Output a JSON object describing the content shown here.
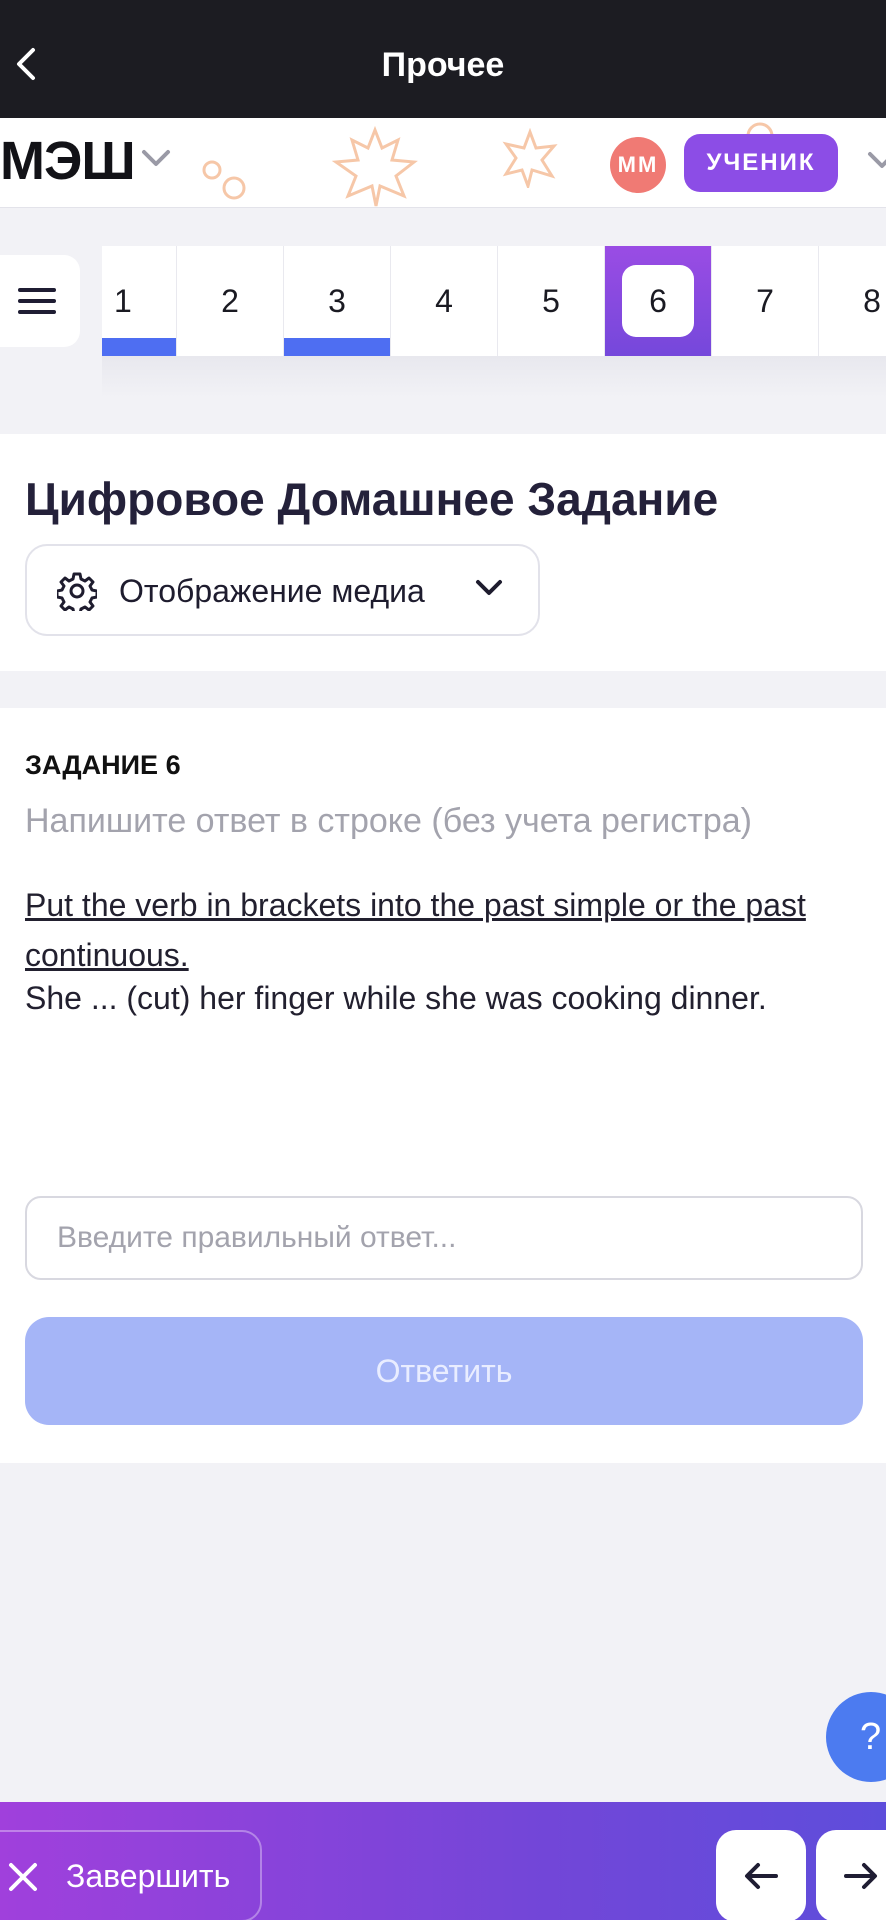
{
  "app_bar": {
    "title": "Прочее"
  },
  "header": {
    "logo": "МЭШ",
    "avatar_initials": "ММ",
    "role_badge": "УЧЕНИК"
  },
  "tabs": {
    "items": [
      {
        "label": "1",
        "answered": true
      },
      {
        "label": "2",
        "answered": false
      },
      {
        "label": "3",
        "answered": true
      },
      {
        "label": "4",
        "answered": false
      },
      {
        "label": "5",
        "answered": false
      },
      {
        "label": "6",
        "answered": false,
        "active": true
      },
      {
        "label": "7",
        "answered": false
      },
      {
        "label": "8",
        "answered": false
      }
    ]
  },
  "page": {
    "title": "Цифровое Домашнее Задание",
    "media_button": "Отображение медиа"
  },
  "task": {
    "number_label": "ЗАДАНИЕ 6",
    "hint": "Напишите ответ в строке (без учета регистра)",
    "instruction": "Put the verb in brackets into the past simple or the past continuous.",
    "sentence": "She ... (cut) her finger while she was cooking dinner.",
    "input_placeholder": "Введите правильный ответ...",
    "submit_label": "Ответить"
  },
  "help": {
    "label": "?"
  },
  "bottom_bar": {
    "finish_label": "Завершить"
  },
  "colors": {
    "accent_purple": "#8c4de6",
    "answered_bar": "#4e6ef2",
    "submit_disabled": "#a5b5f7",
    "avatar_bg": "#f07a74",
    "help_fab": "#4c7bf0"
  }
}
